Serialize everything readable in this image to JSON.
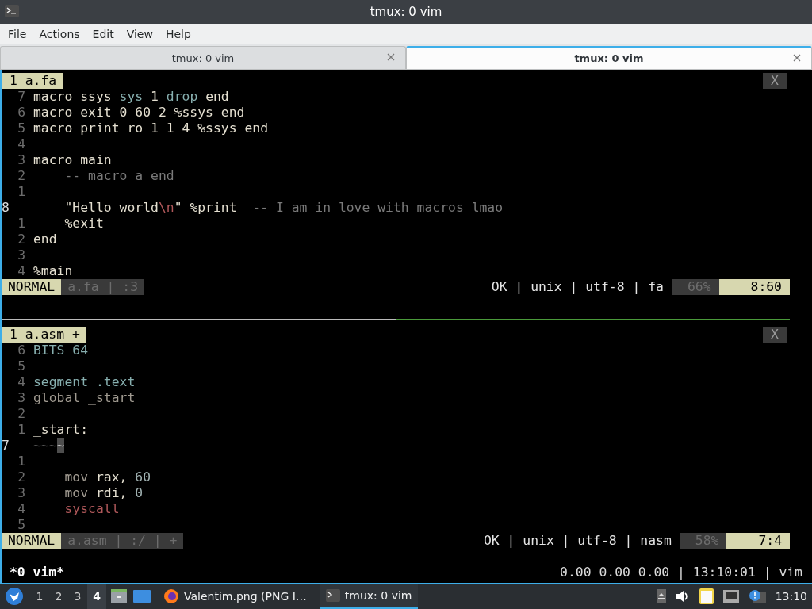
{
  "window": {
    "title": "tmux: 0 vim"
  },
  "menu": [
    "File",
    "Actions",
    "Edit",
    "View",
    "Help"
  ],
  "tabs": [
    {
      "label": "tmux: 0 vim",
      "selected": false
    },
    {
      "label": "tmux: 0 vim",
      "selected": true
    }
  ],
  "panes": [
    {
      "buffer_tab": "1 a.fa",
      "close_label": "X",
      "lines": [
        {
          "number": "7",
          "current": false,
          "tokens": [
            {
              "text": "macro ssys ",
              "kind": "plain"
            },
            {
              "text": "sys",
              "kind": "builtin"
            },
            {
              "text": " 1 ",
              "kind": "plain"
            },
            {
              "text": "drop",
              "kind": "builtin"
            },
            {
              "text": " end",
              "kind": "plain"
            }
          ]
        },
        {
          "number": "6",
          "current": false,
          "tokens": [
            {
              "text": "macro exit 0 60 2 %ssys end",
              "kind": "plain"
            }
          ]
        },
        {
          "number": "5",
          "current": false,
          "tokens": [
            {
              "text": "macro print ro 1 1 4 %ssys end",
              "kind": "plain"
            }
          ]
        },
        {
          "number": "4",
          "current": false
        },
        {
          "number": "3",
          "current": false,
          "tokens": [
            {
              "text": "macro main",
              "kind": "plain"
            }
          ]
        },
        {
          "number": "2",
          "current": false,
          "tokens": [
            {
              "text": "    -- macro a end",
              "kind": "comment"
            }
          ]
        },
        {
          "number": "1",
          "current": false
        },
        {
          "number": "8",
          "current": true,
          "tokens": [
            {
              "text": "    \"Hello world",
              "kind": "plain"
            },
            {
              "text": "\\n",
              "kind": "escape"
            },
            {
              "text": "\" %print  ",
              "kind": "plain"
            },
            {
              "text": "-- I am in love with macros lmao",
              "kind": "comment"
            }
          ]
        },
        {
          "number": "1",
          "current": false,
          "tokens": [
            {
              "text": "    %exit",
              "kind": "plain"
            }
          ]
        },
        {
          "number": "2",
          "current": false,
          "tokens": [
            {
              "text": "end",
              "kind": "plain"
            }
          ]
        },
        {
          "number": "3",
          "current": false
        },
        {
          "number": "4",
          "current": false,
          "tokens": [
            {
              "text": "%main",
              "kind": "plain"
            }
          ]
        }
      ],
      "status": {
        "mode": "NORMAL",
        "file_info": "a.fa | :3",
        "info": "OK | unix | utf-8 | fa",
        "percent": "66%",
        "position": "8:60"
      }
    },
    {
      "buffer_tab": "1 a.asm +",
      "close_label": "X",
      "lines": [
        {
          "number": "6",
          "current": false,
          "tokens": [
            {
              "text": "BITS 64",
              "kind": "builtin"
            }
          ]
        },
        {
          "number": "5",
          "current": false
        },
        {
          "number": "4",
          "current": false,
          "tokens": [
            {
              "text": "segment .text",
              "kind": "builtin"
            }
          ]
        },
        {
          "number": "3",
          "current": false,
          "tokens": [
            {
              "text": "global _start",
              "kind": "muted"
            }
          ]
        },
        {
          "number": "2",
          "current": false
        },
        {
          "number": "1",
          "current": false,
          "tokens": [
            {
              "text": "_start:",
              "kind": "plain"
            }
          ]
        },
        {
          "number": "7",
          "current": true,
          "tokens": [
            {
              "text": "~~~",
              "kind": "nontext"
            },
            {
              "text": "~",
              "kind": "cursor"
            }
          ]
        },
        {
          "number": "1",
          "current": false
        },
        {
          "number": "2",
          "current": false,
          "tokens": [
            {
              "text": "    mov ",
              "kind": "muted"
            },
            {
              "text": "rax, ",
              "kind": "plain"
            },
            {
              "text": "60",
              "kind": "number"
            }
          ]
        },
        {
          "number": "3",
          "current": false,
          "tokens": [
            {
              "text": "    mov ",
              "kind": "muted"
            },
            {
              "text": "rdi, ",
              "kind": "plain"
            },
            {
              "text": "0",
              "kind": "number"
            }
          ]
        },
        {
          "number": "4",
          "current": false,
          "tokens": [
            {
              "text": "    syscall",
              "kind": "escape"
            }
          ]
        },
        {
          "number": "5",
          "current": false
        }
      ],
      "status": {
        "mode": "NORMAL",
        "file_info": "a.asm | :/ | +",
        "info": "OK | unix | utf-8 | nasm",
        "percent": "58%",
        "position": "7:4"
      }
    }
  ],
  "tmux_status": {
    "left": "*0 vim*",
    "right": "0.00 0.00 0.00 | 13:10:01 | vim"
  },
  "taskbar": {
    "workspaces": [
      {
        "label": "1",
        "selected": false
      },
      {
        "label": "2",
        "selected": false
      },
      {
        "label": "3",
        "selected": false
      },
      {
        "label": "4",
        "selected": true
      }
    ],
    "tasks": [
      {
        "kind": "browser",
        "label": "Valentim.png (PNG I…",
        "selected": false
      },
      {
        "kind": "terminal",
        "label": "tmux: 0 vim",
        "selected": true
      }
    ],
    "clock": "13:10"
  }
}
